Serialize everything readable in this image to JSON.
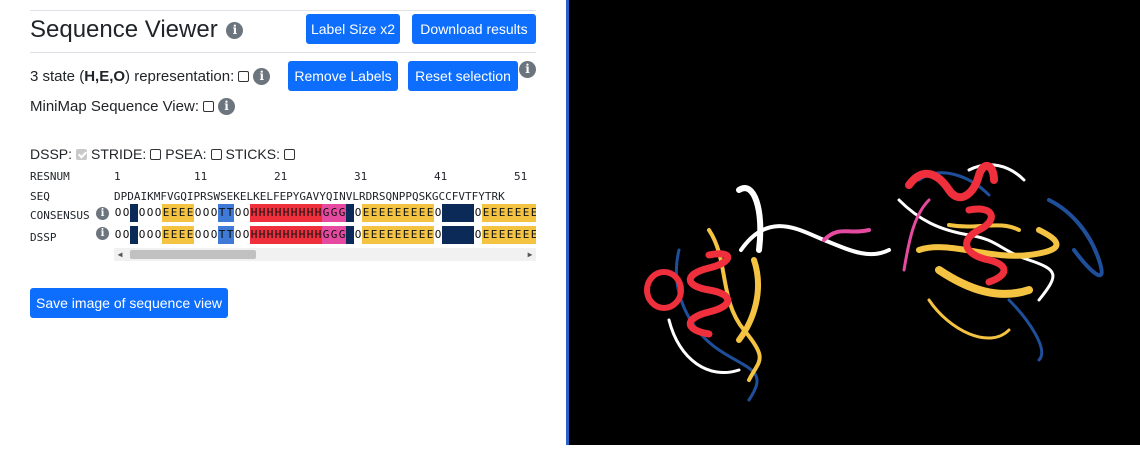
{
  "header": {
    "title": "Sequence Viewer",
    "label_size_button": "Label Size x2",
    "download_button": "Download results"
  },
  "options": {
    "three_state_prefix": "3 state (",
    "three_state_bold": "H,E,O",
    "three_state_suffix": ") representation:",
    "remove_labels_button": "Remove Labels",
    "reset_selection_button": "Reset selection",
    "minimap_label": "MiniMap Sequence View:"
  },
  "methods": {
    "dssp": "DSSP:",
    "stride": "STRIDE:",
    "psea": "PSEA:",
    "sticks": "STICKS:"
  },
  "sequence": {
    "resnum_label": "RESNUM",
    "resnum_marks": [
      "1",
      "11",
      "21",
      "31",
      "41",
      "51"
    ],
    "seq_label": "SEQ",
    "seq": "DPDAIKMFVGQIPRSWSEKELKELFEPYGAVYQINVLRDRSQNPPQSKGCCFVTFYTRK",
    "consensus_label": "CONSENSUS",
    "dssp_label": "DSSP",
    "consensus_track": "OOSOOOEEEEOOOTTOOHHHHHHHHHGGGSOEEEEEEEEEOSSSSOEEEEEEEEEESSHH",
    "dssp_track": "OOSOOOEEEEOOOTTOOHHHHHHHHHGGGSOEEEEEEEEEOSSSSOEEEEEEEEEESSHH"
  },
  "save_button": "Save image of sequence view",
  "colors": {
    "O": "#ffffff",
    "S": "#0b2a57",
    "E": "#f5c342",
    "T": "#3f7bd6",
    "H": "#ef2f3c",
    "G": "#e64aa0",
    "button": "#0d6efd"
  },
  "icons": {
    "info": "info-icon"
  }
}
